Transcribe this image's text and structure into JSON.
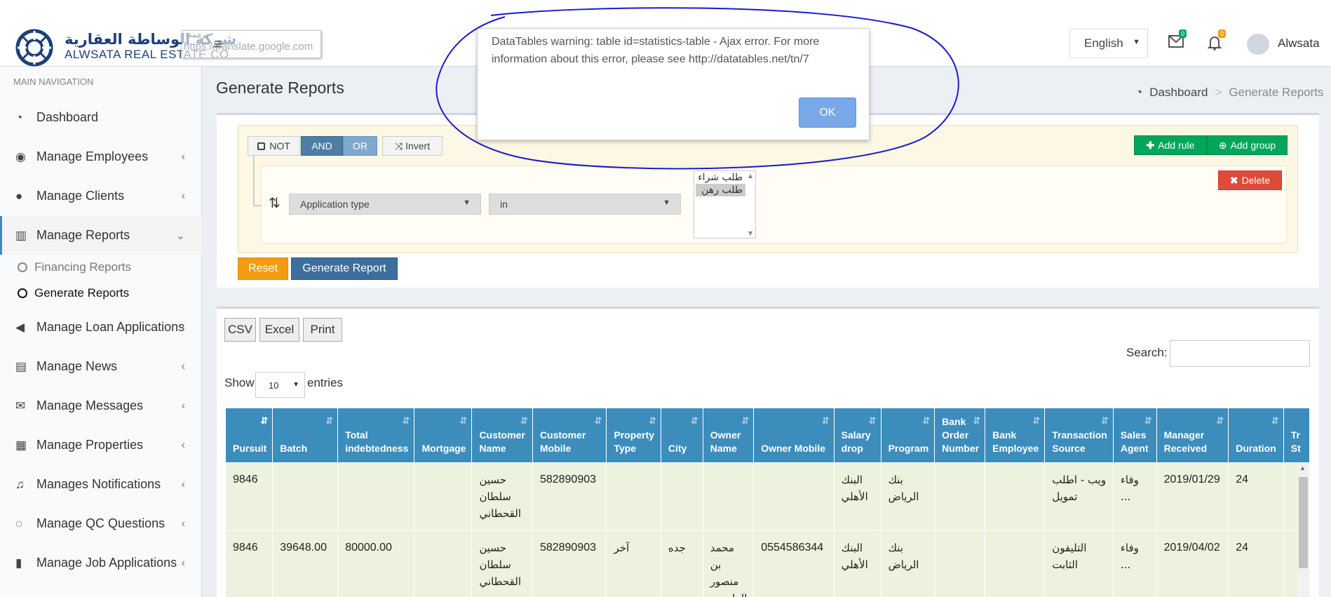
{
  "brand": {
    "arabic": "شركة الوساطة العقارية",
    "english": "ALWSATA REAL ESTATE CO"
  },
  "translate_overlay": {
    "label": "ترجمة",
    "url": "https://translate.google.com"
  },
  "header": {
    "language": "English",
    "messages_count": "0",
    "notifications_count": "0",
    "user_name": "Alwsata",
    "colors": {
      "messages_badge": "#00a65a",
      "notifications_badge": "#f39c12"
    }
  },
  "sidebar": {
    "header": "MAIN NAVIGATION",
    "items": [
      {
        "label": "Dashboard",
        "icon": "dashboard-icon"
      },
      {
        "label": "Manage Employees",
        "icon": "employee-icon"
      },
      {
        "label": "Manage Clients",
        "icon": "users-icon"
      },
      {
        "label": "Manage Reports",
        "icon": "bar-chart-icon"
      },
      {
        "label": "Manage Loan Applications",
        "icon": "bullhorn-icon"
      },
      {
        "label": "Manage News",
        "icon": "newspaper-icon"
      },
      {
        "label": "Manage Messages",
        "icon": "envelope-icon"
      },
      {
        "label": "Manage Properties",
        "icon": "building-icon"
      },
      {
        "label": "Manages Notifications",
        "icon": "bell-icon"
      },
      {
        "label": "Manage QC Questions",
        "icon": "comment-icon"
      },
      {
        "label": "Manage Job Applications",
        "icon": "book-icon"
      }
    ],
    "sub_items": [
      {
        "label": "Financing Reports"
      },
      {
        "label": "Generate Reports"
      }
    ]
  },
  "page": {
    "title": "Generate Reports",
    "breadcrumb": {
      "home": "Dashboard",
      "separator": ">",
      "current": "Generate Reports"
    }
  },
  "query_builder": {
    "not_label": "NOT",
    "and_label": "AND",
    "or_label": "OR",
    "invert_label": "Invert",
    "add_rule_label": "Add rule",
    "add_group_label": "Add group",
    "delete_label": "Delete",
    "field_value": "Application type",
    "operator_value": "in",
    "value_options": [
      "طلب شراء",
      "طلب رهن"
    ],
    "selected_value": "طلب رهن",
    "reset_label": "Reset",
    "generate_label": "Generate Report"
  },
  "table_tools": {
    "export_buttons": [
      "CSV",
      "Excel",
      "Print"
    ],
    "search_label": "Search:",
    "search_value": "",
    "show_label": "Show",
    "length_value": "10",
    "entries_label": "entries"
  },
  "table": {
    "columns": [
      "Pursuit",
      "Batch",
      "Total indebtedness",
      "Mortgage",
      "Customer Name",
      "Customer Mobile",
      "Property Type",
      "City",
      "Owner Name",
      "Owner Mobile",
      "Salary drop",
      "Program",
      "Bank Order Number",
      "Bank Employee",
      "Transaction Source",
      "Sales Agent",
      "Manager Received",
      "Duration",
      "Tr St"
    ],
    "rows": [
      [
        "9846",
        "",
        "",
        "",
        "حسين سلطان القحطاني",
        "582890903",
        "",
        "",
        "",
        "",
        "البنك الأهلي",
        "بنك الرياض",
        "",
        "",
        "ويب - اطلب تمويل",
        "وفاء ...",
        "2019/01/29",
        "24",
        ""
      ],
      [
        "9846",
        "39648.00",
        "80000.00",
        "",
        "حسين سلطان القحطاني",
        "582890903",
        "آخر",
        "جده",
        "محمد بن منصور الراجحي",
        "0554586344",
        "البنك الأهلي",
        "بنك الرياض",
        "",
        "",
        "التليفون الثابت",
        "وفاء ...",
        "2019/04/02",
        "24",
        ""
      ]
    ]
  },
  "dialog": {
    "message": "DataTables warning: table id=statistics-table - Ajax error. For more information about this error, please see http://datatables.net/tn/7",
    "ok_label": "OK"
  },
  "colors": {
    "header_bg": "#3c8dbc",
    "row_bg": "#ecf2dd",
    "annotation": "#1a1acc"
  }
}
